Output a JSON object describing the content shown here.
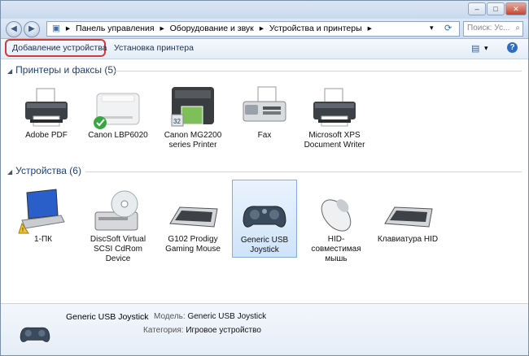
{
  "window": {
    "controls": [
      "–",
      "□",
      "✕"
    ]
  },
  "address": {
    "crumbs": [
      "Панель управления",
      "Оборудование и звук",
      "Устройства и принтеры"
    ],
    "search_placeholder": "Поиск: Ус..."
  },
  "toolbar": {
    "add_device": "Добавление устройства",
    "add_printer": "Установка принтера"
  },
  "groups": {
    "printers": {
      "title": "Принтеры и факсы (5)",
      "items": [
        {
          "label": "Adobe PDF",
          "icon": "printer-icon"
        },
        {
          "label": "Canon LBP6020",
          "icon": "laser-printer-icon",
          "default": true
        },
        {
          "label": "Canon MG2200 series Printer",
          "icon": "inkjet-printer-icon"
        },
        {
          "label": "Fax",
          "icon": "fax-icon"
        },
        {
          "label": "Microsoft XPS Document Writer",
          "icon": "printer-icon"
        }
      ]
    },
    "devices": {
      "title": "Устройства (6)",
      "items": [
        {
          "label": "1-ПК",
          "icon": "laptop-icon"
        },
        {
          "label": "DiscSoft Virtual SCSI CdRom Device",
          "icon": "cdrom-icon"
        },
        {
          "label": "G102 Prodigy Gaming Mouse",
          "icon": "keyboard-icon"
        },
        {
          "label": "Generic   USB Joystick",
          "icon": "joystick-icon",
          "selected": true
        },
        {
          "label": "HID-совместимая мышь",
          "icon": "mouse-icon"
        },
        {
          "label": "Клавиатура HID",
          "icon": "keyboard-icon"
        }
      ]
    }
  },
  "details": {
    "name": "Generic   USB  Joystick",
    "model_label": "Модель:",
    "model_value": "Generic   USB  Joystick",
    "category_label": "Категория:",
    "category_value": "Игровое устройство"
  }
}
